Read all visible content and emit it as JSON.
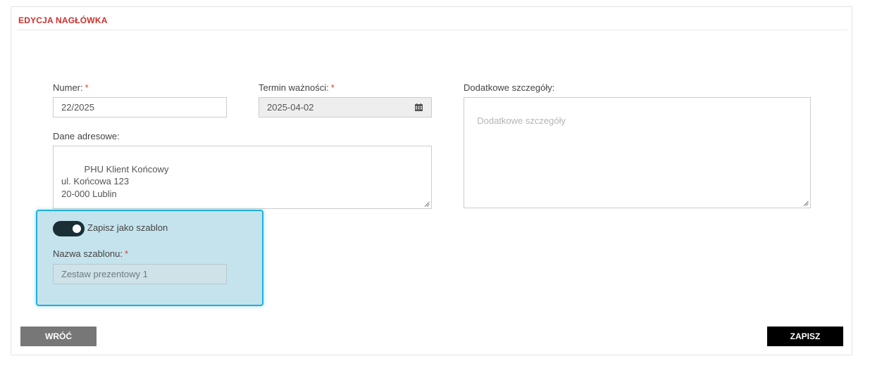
{
  "panel": {
    "title": "EDYCJA NAGŁÓWKA"
  },
  "form": {
    "number": {
      "label": "Numer:",
      "required_mark": "*",
      "value": "22/2025"
    },
    "expiry": {
      "label": "Termin ważności:",
      "required_mark": "*",
      "value": "2025-04-02",
      "icon": "calendar-icon"
    },
    "details": {
      "label": "Dodatkowe szczegóły:",
      "placeholder": "Dodatkowe szczegóły",
      "value": ""
    },
    "address": {
      "label": "Dane adresowe:",
      "value": "       PHU Klient Końcowy\nul. Końcowa 123\n20-000 Lublin"
    },
    "save_as_template": {
      "label": "Zapisz jako szablon",
      "checked": true
    },
    "template_name": {
      "label": "Nazwa szablonu:",
      "required_mark": "*",
      "value": "Zestaw prezentowy 1"
    }
  },
  "actions": {
    "back_label": "WRÓĆ",
    "save_label": "ZAPISZ"
  },
  "colors": {
    "title": "#c9302c",
    "required": "#d9413a",
    "highlight_bg": "#c5e3ec",
    "highlight_border": "#1fb0df",
    "toggle_on": "#1a2e36",
    "back_button": "#777777",
    "save_button": "#000000"
  }
}
